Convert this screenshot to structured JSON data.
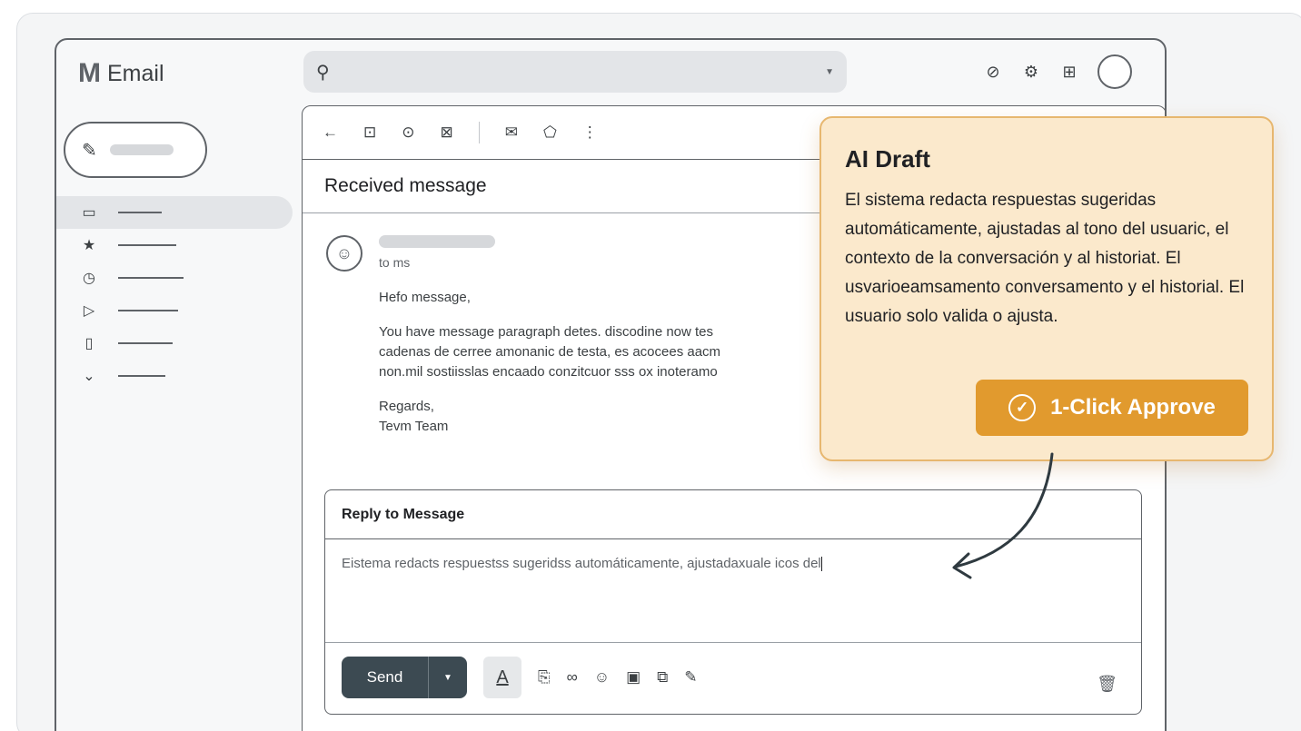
{
  "app": {
    "logo_letter": "M",
    "title": "Email"
  },
  "search": {
    "placeholder": "",
    "dropdown_icon": "caret-down"
  },
  "header_icons": [
    "help-icon",
    "settings-icon",
    "apps-icon"
  ],
  "toolbar_icons": [
    "back-arrow",
    "archive",
    "report-spam",
    "delete",
    "mark-unread",
    "label",
    "more"
  ],
  "message": {
    "subject": "Received message",
    "to": "to ms",
    "greeting": "Hefo message,",
    "paragraph_lines": [
      "You have message paragraph detes. discodine now tes",
      "cadenas de cerree amonanic de testa, es acocees aacm",
      "non.mil sostiisslas encaado conzitcuor sss ox inoteramo"
    ],
    "signoff": "Regards,",
    "signature": "Tevm Team"
  },
  "reply": {
    "header": "Reply to Message",
    "draft_text": "Eistema redacts respuestss sugeridss automáticamente, ajustadaxuale icos del",
    "send_label": "Send"
  },
  "ai_card": {
    "title": "AI Draft",
    "description": "El sistema redacta respuestas sugeridas automáticamente, ajustadas al tono del usuaric, el contexto de la conversación y al historiat. El usvarioeamsamento conversamento y el historial. El usuario solo valida o ajusta.",
    "button_label": "1-Click Approve",
    "accent_color": "#e19a2e",
    "background_color": "#fbe9cc"
  }
}
